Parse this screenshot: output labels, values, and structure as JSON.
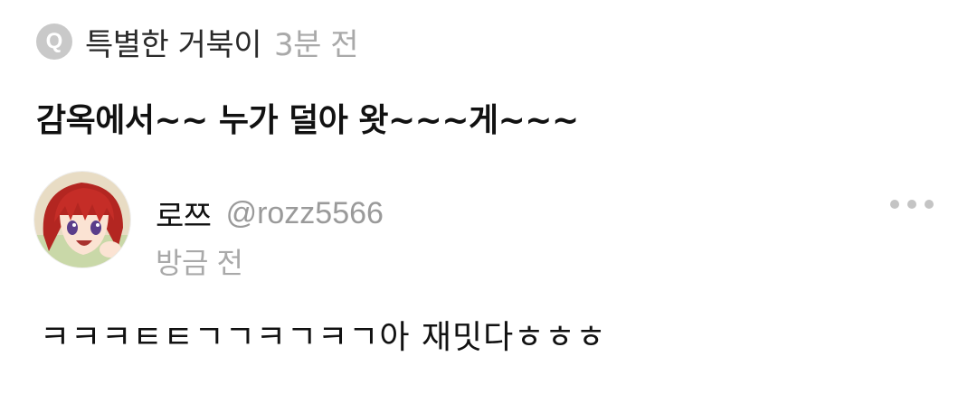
{
  "question": {
    "badge_letter": "Q",
    "asker_name": "특별한 거북이",
    "asked_time": "3분 전",
    "text": "감옥에서~~ 누가 덜아 왓~~~게~~~"
  },
  "answer": {
    "avatar_icon": "anime-character-avatar",
    "name": "로쯔",
    "handle": "@rozz5566",
    "time": "방금 전",
    "more_icon": "more-dots-icon",
    "text": "ㅋㅋㅋㅌㅌㄱㄱㅋㄱㅋㄱ아 재밋다ㅎㅎㅎ"
  },
  "colors": {
    "badge_bg": "#c9c9c9",
    "muted_text": "#a9a9a9",
    "primary_text": "#111111"
  }
}
